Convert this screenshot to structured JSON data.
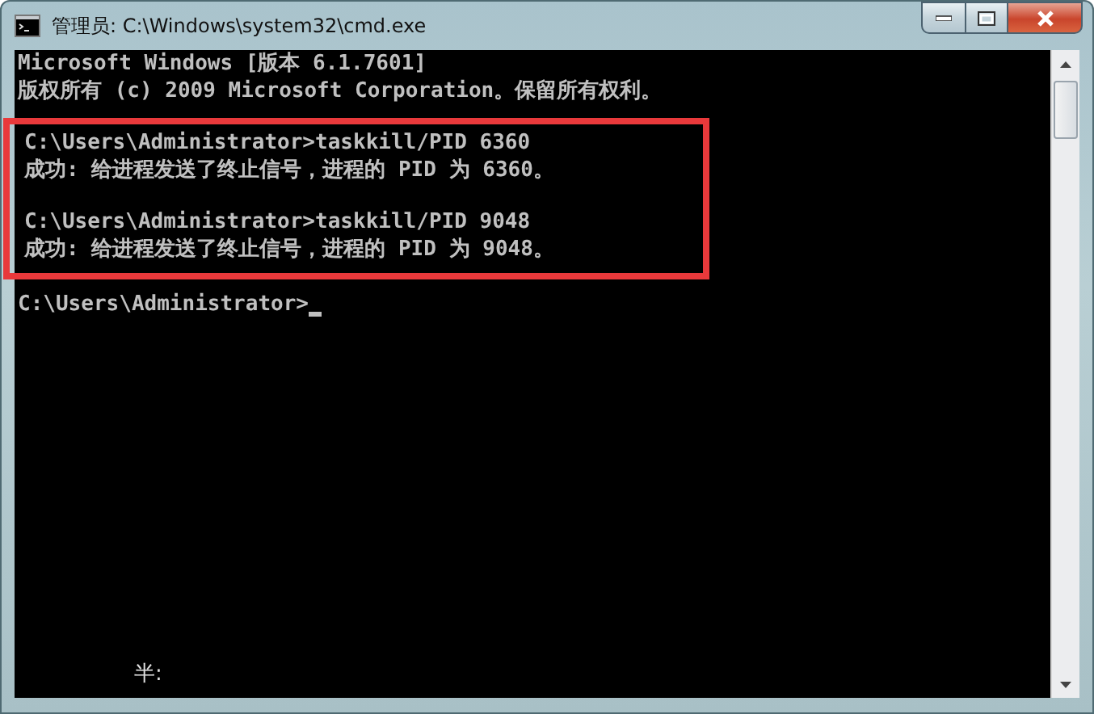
{
  "window": {
    "title": "管理员: C:\\Windows\\system32\\cmd.exe"
  },
  "console": {
    "blocks": [
      {
        "highlighted": false,
        "paragraphs": [
          [
            "Microsoft Windows [版本 6.1.7601]",
            "版权所有 (c) 2009 Microsoft Corporation。保留所有权利。"
          ]
        ]
      },
      {
        "highlighted": true,
        "paragraphs": [
          [
            "C:\\Users\\Administrator>taskkill/PID 6360",
            "成功: 给进程发送了终止信号，进程的 PID 为 6360。"
          ],
          [
            "C:\\Users\\Administrator>taskkill/PID 9048",
            "成功: 给进程发送了终止信号，进程的 PID 为 9048。"
          ]
        ]
      },
      {
        "highlighted": false,
        "paragraphs": [
          [
            "C:\\Users\\Administrator>"
          ]
        ]
      }
    ],
    "cursor_visible": true
  },
  "ime_status": "半:"
}
